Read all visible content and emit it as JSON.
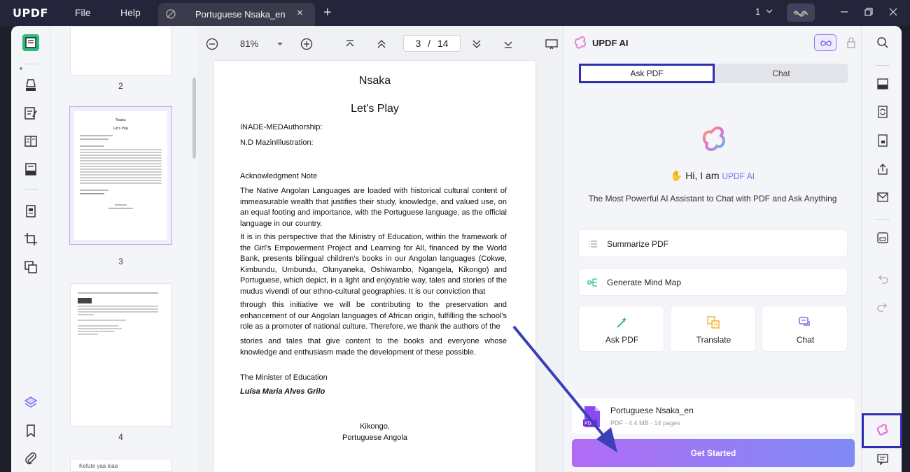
{
  "titlebar": {
    "logo": "UPDF",
    "menu_file": "File",
    "menu_help": "Help",
    "tab_title": "Portuguese Nsaka_en",
    "tab_close": "×",
    "tab_add": "+",
    "page_select": "1"
  },
  "thumbnails": {
    "pages": [
      {
        "num": "2"
      },
      {
        "num": "3",
        "title": "Nsaka",
        "subtitle": "Let's Play"
      },
      {
        "num": "4"
      }
    ],
    "partial_next": "Kefute yaa kiaa"
  },
  "toolbar": {
    "zoom": "81%",
    "current_page": "3",
    "page_sep": "/",
    "total_pages": "14"
  },
  "document": {
    "title": "Nsaka",
    "subtitle": "Let's Play",
    "author_line": "INADE-MEDAuthorship:",
    "illus_line": "N.D MazinIllustration:",
    "ack_heading": "Acknowledgment Note",
    "para1": "The Native Angolan Languages are loaded with historical cultural content of immeasurable wealth that justifies their study, knowledge, and valued use, on an equal footing and importance, with the Portuguese language, as the official language in our country.",
    "para2": "It is in this perspective that the Ministry of Education, within the framework of the Girl's Empowerment Project and Learning for All, financed by the World Bank, presents bilingual children's books in our Angolan languages (Cokwe, Kimbundu, Umbundu, Olunyaneka, Oshiwambo, Ngangela, Kikongo) and Portuguese, which depict, in a light and enjoyable way, tales and stories of the mudus vivendi of our ethno-cultural geographies. It is our conviction that",
    "para3": "through this initiative we will be contributing to the preservation and enhancement of our Angolan languages of African origin, fulfilling the school's role as a promoter of national culture. Therefore, we thank the authors of the",
    "para4": "stories and tales that give content to the books and everyone whose knowledge and enthusiasm made the development of these possible.",
    "minister": "The Minister of Education",
    "signature": "Luísa Maria Alves Grilo",
    "place1": "Kikongo,",
    "place2": "Portuguese Angola"
  },
  "ai_panel": {
    "title": "UPDF AI",
    "tab_ask": "Ask PDF",
    "tab_chat": "Chat",
    "greeting": "Hi, I am",
    "greeting_brand": "UPDF AI",
    "description": "The Most Powerful AI Assistant to Chat with PDF and Ask Anything",
    "summarize": "Summarize PDF",
    "mindmap": "Generate Mind Map",
    "tiles": [
      {
        "label": "Ask PDF"
      },
      {
        "label": "Translate"
      },
      {
        "label": "Chat"
      }
    ],
    "file_name": "Portuguese Nsaka_en",
    "file_meta": "PDF · 4.4 MB · 14 pages",
    "file_badge": "PDF",
    "get_started": "Get Started"
  },
  "colors": {
    "accent": "#7d6cf0",
    "highlight_box": "#2f2fb0",
    "arrow": "#3b3fb8"
  }
}
